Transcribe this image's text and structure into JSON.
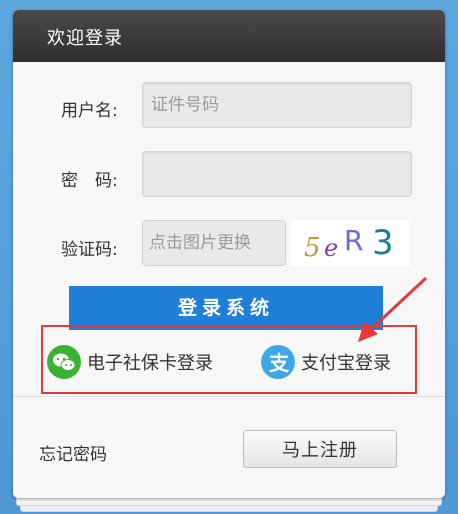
{
  "header": {
    "title": "欢迎登录"
  },
  "form": {
    "username": {
      "label": "用户名:",
      "placeholder": "证件号码",
      "value": ""
    },
    "password": {
      "label": "密　码:",
      "placeholder": "",
      "value": ""
    },
    "captcha": {
      "label": "验证码:",
      "placeholder": "点击图片更换",
      "image_text": "5eR3"
    }
  },
  "login_button": {
    "label": "登录系统"
  },
  "alt_logins": [
    {
      "label": "电子社保卡登录",
      "icon": "wechat-icon"
    },
    {
      "label": "支付宝登录",
      "icon": "alipay-icon"
    }
  ],
  "footer": {
    "forgot_password": "忘记密码",
    "register_button": "马上注册"
  },
  "colors": {
    "accent": "#1f7ed8",
    "highlight_border": "#e23b3b",
    "wechat_green": "#3cb034",
    "alipay_blue": "#3ea7e6"
  }
}
